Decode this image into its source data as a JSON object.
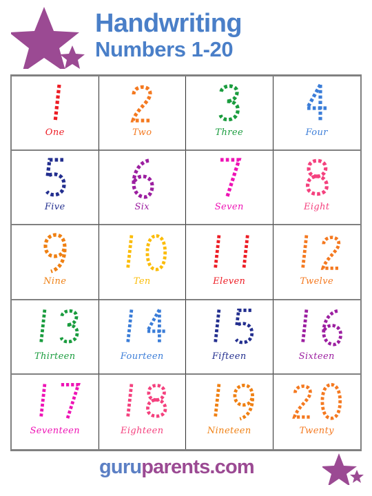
{
  "header": {
    "title_line1": "Handwriting",
    "title_line2": "Numbers 1-20",
    "title_color": "#4a7fc8",
    "star_color": "#9b4a93",
    "star_icon": "star-icon",
    "small_star_icon": "small-star-icon"
  },
  "worksheet": {
    "rows": 5,
    "columns": 4,
    "border_color": "#808080",
    "divider_color": "#2b2b2b",
    "cells": [
      {
        "numeral": "1",
        "word": "One",
        "color": "#ed1c24"
      },
      {
        "numeral": "2",
        "word": "Two",
        "color": "#f47920"
      },
      {
        "numeral": "3",
        "word": "Three",
        "color": "#1a9c3e"
      },
      {
        "numeral": "4",
        "word": "Four",
        "color": "#3b7dd8"
      },
      {
        "numeral": "5",
        "word": "Five",
        "color": "#232f8f"
      },
      {
        "numeral": "6",
        "word": "Six",
        "color": "#9c1fa0"
      },
      {
        "numeral": "7",
        "word": "Seven",
        "color": "#ee13b5"
      },
      {
        "numeral": "8",
        "word": "Eight",
        "color": "#f4417e"
      },
      {
        "numeral": "9",
        "word": "Nine",
        "color": "#ef8013"
      },
      {
        "numeral": "10",
        "word": "Ten",
        "color": "#fbbc08"
      },
      {
        "numeral": "11",
        "word": "Eleven",
        "color": "#ed1c24"
      },
      {
        "numeral": "12",
        "word": "Twelve",
        "color": "#f47920"
      },
      {
        "numeral": "13",
        "word": "Thirteen",
        "color": "#1a9c3e"
      },
      {
        "numeral": "14",
        "word": "Fourteen",
        "color": "#3b7dd8"
      },
      {
        "numeral": "15",
        "word": "Fifteen",
        "color": "#232f8f"
      },
      {
        "numeral": "16",
        "word": "Sixteen",
        "color": "#9c1fa0"
      },
      {
        "numeral": "17",
        "word": "Seventeen",
        "color": "#ee13b5"
      },
      {
        "numeral": "18",
        "word": "Eighteen",
        "color": "#f4417e"
      },
      {
        "numeral": "19",
        "word": "Nineteen",
        "color": "#ef8013"
      },
      {
        "numeral": "20",
        "word": "Twenty",
        "color": "#f47920"
      }
    ]
  },
  "footer": {
    "brand_part1": "guru",
    "brand_part2": "parents.com",
    "brand_color1": "#5b7fc4",
    "brand_color2": "#9b4a93",
    "star_icon": "star-icon",
    "small_star_icon": "small-star-icon",
    "star_color": "#9b4a93"
  }
}
